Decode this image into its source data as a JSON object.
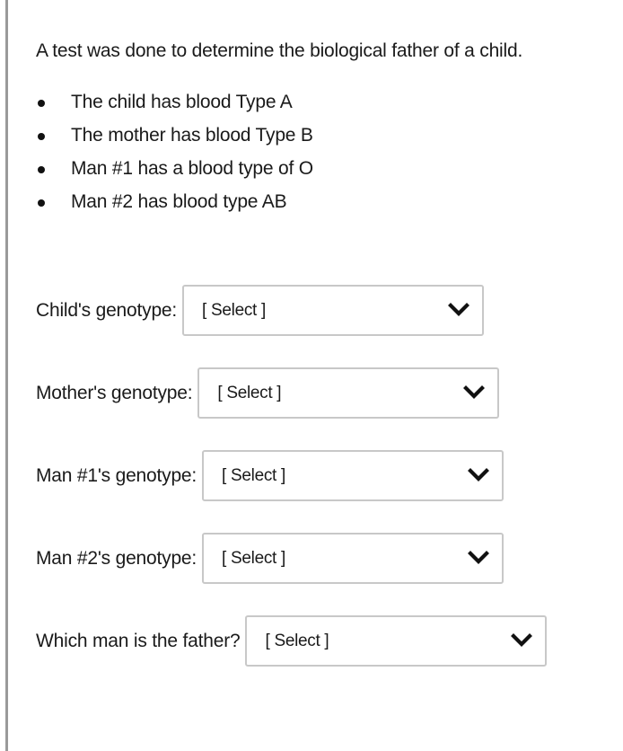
{
  "question": {
    "intro": "A test was done to determine the biological father of a child.",
    "facts": [
      "The child has blood Type A",
      "The mother has blood Type B",
      "Man #1 has a blood type of O",
      "Man #2 has blood type AB"
    ]
  },
  "dropdowns": [
    {
      "label": "Child's genotype:",
      "value": "[ Select ]",
      "icon": "chevron-down-icon"
    },
    {
      "label": "Mother's genotype:",
      "value": "[ Select ]",
      "icon": "chevron-down-icon"
    },
    {
      "label": "Man #1's genotype:",
      "value": "[ Select ]",
      "icon": "chevron-down-icon"
    },
    {
      "label": "Man #2's genotype:",
      "value": "[ Select ]",
      "icon": "chevron-down-icon"
    },
    {
      "label": "Which man is the father?",
      "value": "[ Select ]",
      "icon": "chevron-down-icon"
    }
  ],
  "colors": {
    "text": "#1a1a1a",
    "select_border": "#c8c8c8",
    "left_rule": "#9a9a9a"
  }
}
